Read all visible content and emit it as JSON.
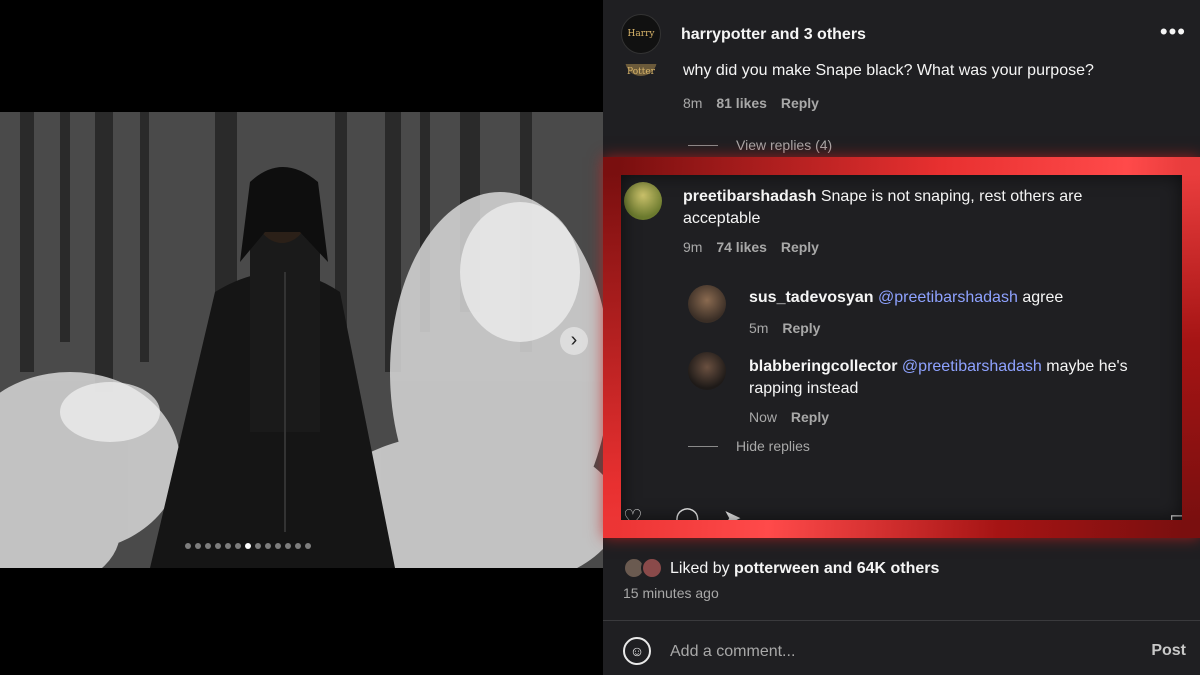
{
  "header": {
    "username": "harrypotter",
    "suffix": "and 3 others",
    "avatar_label": "Harry Potter"
  },
  "comments": [
    {
      "text": "why did you make Snape black? What was your purpose?",
      "time": "8m",
      "likes": "81 likes",
      "reply": "Reply",
      "view_replies": "View replies (4)"
    },
    {
      "user": "preetibarshadash",
      "text": "Snape is not snaping, rest others are acceptable",
      "time": "9m",
      "likes": "74 likes",
      "reply": "Reply",
      "replies": [
        {
          "user": "sus_tadevosyan",
          "mention": "@preetibarshadash",
          "text": "agree",
          "time": "5m",
          "reply": "Reply"
        },
        {
          "user": "blabberingcollector",
          "mention": "@preetibarshadash",
          "text_line1": "maybe he's",
          "text_line2": "rapping instead",
          "time": "Now",
          "reply": "Reply"
        }
      ],
      "hide_replies": "Hide replies"
    }
  ],
  "likes": {
    "prefix": "Liked by",
    "user": "potterween",
    "rest": "and 64K others"
  },
  "time_ago": "15 minutes ago",
  "composer": {
    "placeholder": "Add a comment...",
    "post_label": "Post"
  },
  "carousel": {
    "total": 13,
    "active_index": 6
  },
  "colors": {
    "highlight": "#c81f1f",
    "mention": "#8ea2ff",
    "panel_bg": "#1f1f22"
  }
}
